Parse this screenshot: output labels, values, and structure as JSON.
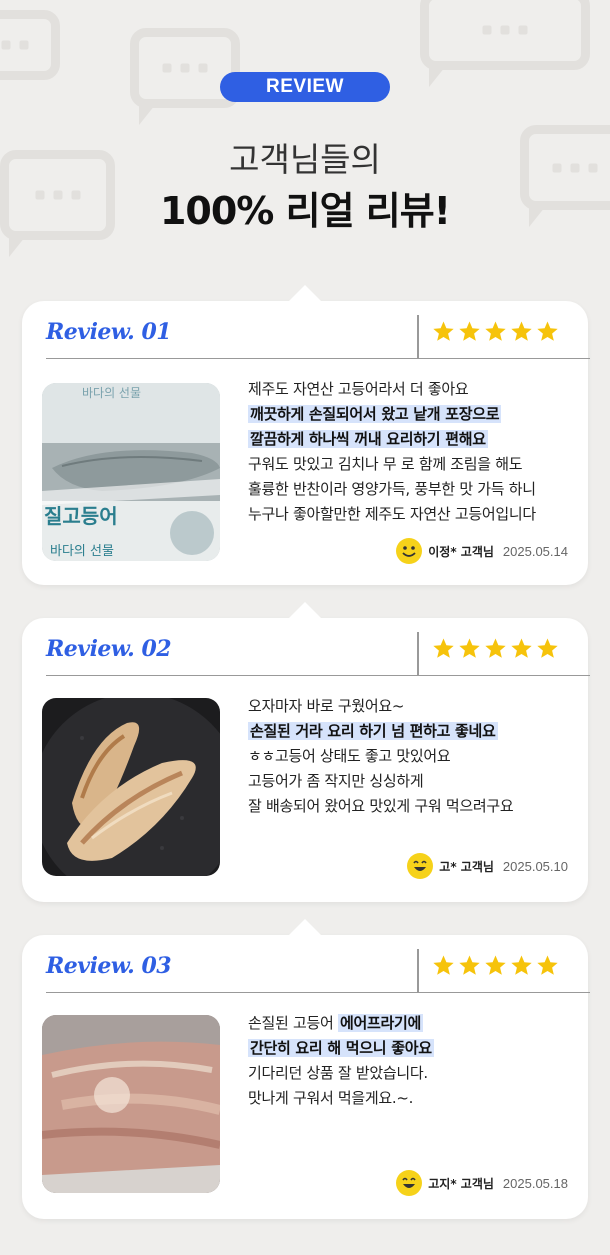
{
  "header": {
    "badge": "REVIEW",
    "headline_line1": "고객님들의",
    "headline_line2": "100% 리얼 리뷰!"
  },
  "colors": {
    "accent": "#2f5fe3",
    "star": "#f6c30b",
    "highlight": "#d6e3fb",
    "background": "#efeeec"
  },
  "reviews": [
    {
      "title": "Review. 01",
      "rating": 5,
      "lines": [
        {
          "text": "제주도 자연산 고등어라서 더 좋아요",
          "highlight": false
        },
        {
          "text": "깨끗하게 손질되어서 왔고 낱개 포장으로",
          "highlight": true
        },
        {
          "text": "깔끔하게 하나씩 꺼내 요리하기 편해요",
          "highlight": true
        },
        {
          "text": "구워도 맛있고 김치나 무 로 함께 조림을 해도",
          "highlight": false
        },
        {
          "text": "훌륭한 반찬이라 영양가득, 풍부한 맛 가득 하니",
          "highlight": false
        },
        {
          "text": "누구나 좋아할만한 제주도 자연산 고등어입니다",
          "highlight": false
        }
      ],
      "author": "이정* 고객님",
      "date": "2025.05.14",
      "image_icon": "packaged-mackerel-photo",
      "package_text_1": "바다의 선물",
      "package_text_2": "질고등어"
    },
    {
      "title": "Review. 02",
      "rating": 5,
      "lines": [
        {
          "text": "오자마자 바로 구웠어요~",
          "highlight": false
        },
        {
          "text": "손질된 거라 요리 하기 넘 편하고 좋네요",
          "highlight": true
        },
        {
          "text": "ㅎㅎ고등어 상태도 좋고 맛있어요",
          "highlight": false
        },
        {
          "text": "고등어가 좀 작지만 싱싱하게",
          "highlight": false
        },
        {
          "text": "잘 배송되어 왔어요 맛있게 구워 먹으려구요",
          "highlight": false
        }
      ],
      "author": "고* 고객님",
      "date": "2025.05.10",
      "image_icon": "grilled-mackerel-pan-photo"
    },
    {
      "title": "Review. 03",
      "rating": 5,
      "lines": [
        {
          "text": "손질된 고등어 ",
          "highlight": false,
          "suffix": "에어프라기에"
        },
        {
          "text": "간단히 요리 해 먹으니 좋아요",
          "highlight": true
        },
        {
          "text": "기다리던 상품 잘 받았습니다.",
          "highlight": false
        },
        {
          "text": "맛나게 구워서 먹을게요.~.",
          "highlight": false
        }
      ],
      "author": "고지* 고객님",
      "date": "2025.05.18",
      "image_icon": "airfried-mackerel-photo"
    }
  ]
}
